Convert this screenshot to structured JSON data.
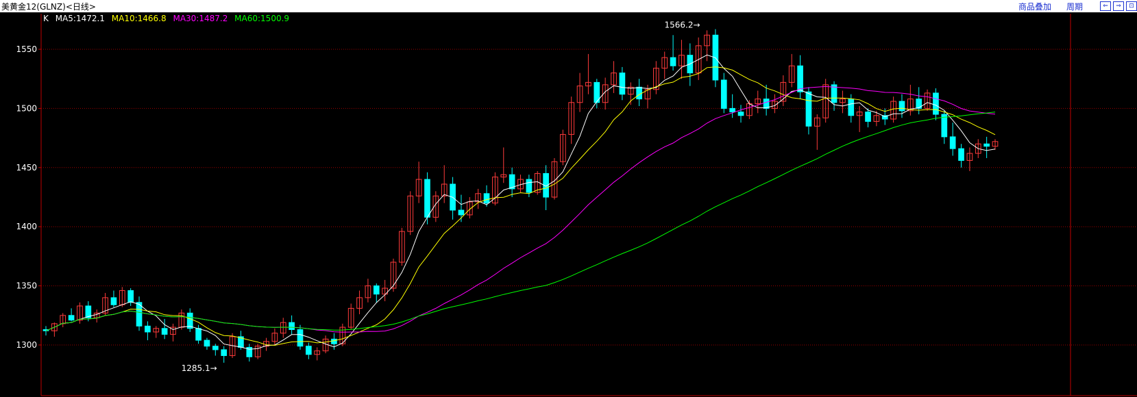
{
  "window": {
    "title": "美黄金12(GLNZ)<日线>",
    "toolbar": {
      "overlay": "商品叠加",
      "period": "周期"
    },
    "buttons": [
      "⇐",
      "⇒",
      "⊡"
    ]
  },
  "legend": {
    "k": "K",
    "ma5": "MA5:1472.1",
    "ma10": "MA10:1466.8",
    "ma30": "MA30:1487.2",
    "ma60": "MA60:1500.9"
  },
  "colors": {
    "background": "#000000",
    "up": "#ff3b3b",
    "down": "#00ffff",
    "ma5": "#ffffff",
    "ma10": "#ffff00",
    "ma30": "#ff00ff",
    "ma60": "#00ff00",
    "grid": "#9e0000",
    "axis": "#c00000"
  },
  "chart_data": {
    "type": "candlestick",
    "y_ticks": [
      1300,
      1350,
      1400,
      1450,
      1500,
      1550
    ],
    "ylim": [
      1285,
      1570
    ],
    "annotations": [
      {
        "label": "1566.2",
        "candle_index": 78
      },
      {
        "label": "1285.1",
        "candle_index": 21
      }
    ],
    "candles": [
      [
        1313,
        1316,
        1308,
        1312
      ],
      [
        1312,
        1319,
        1307,
        1318
      ],
      [
        1318,
        1327,
        1315,
        1325
      ],
      [
        1325,
        1331,
        1320,
        1321
      ],
      [
        1321,
        1336,
        1318,
        1333
      ],
      [
        1333,
        1337,
        1320,
        1323
      ],
      [
        1323,
        1330,
        1319,
        1327
      ],
      [
        1327,
        1344,
        1325,
        1340
      ],
      [
        1340,
        1346,
        1332,
        1334
      ],
      [
        1334,
        1349,
        1332,
        1346
      ],
      [
        1346,
        1348,
        1333,
        1336
      ],
      [
        1336,
        1341,
        1312,
        1316
      ],
      [
        1316,
        1320,
        1304,
        1311
      ],
      [
        1311,
        1316,
        1306,
        1314
      ],
      [
        1314,
        1322,
        1305,
        1309
      ],
      [
        1309,
        1318,
        1303,
        1315
      ],
      [
        1315,
        1330,
        1313,
        1327
      ],
      [
        1327,
        1331,
        1311,
        1314
      ],
      [
        1314,
        1317,
        1301,
        1304
      ],
      [
        1304,
        1306,
        1296,
        1299
      ],
      [
        1299,
        1301,
        1291,
        1296
      ],
      [
        1296,
        1299,
        1285,
        1291
      ],
      [
        1291,
        1310,
        1289,
        1307
      ],
      [
        1307,
        1312,
        1296,
        1298
      ],
      [
        1298,
        1301,
        1286,
        1290
      ],
      [
        1290,
        1301,
        1288,
        1299
      ],
      [
        1299,
        1306,
        1295,
        1303
      ],
      [
        1303,
        1314,
        1300,
        1310
      ],
      [
        1310,
        1323,
        1306,
        1319
      ],
      [
        1319,
        1325,
        1309,
        1313
      ],
      [
        1313,
        1317,
        1296,
        1299
      ],
      [
        1299,
        1302,
        1288,
        1292
      ],
      [
        1292,
        1298,
        1287,
        1295
      ],
      [
        1295,
        1308,
        1293,
        1305
      ],
      [
        1305,
        1310,
        1296,
        1301
      ],
      [
        1301,
        1318,
        1299,
        1315
      ],
      [
        1315,
        1335,
        1313,
        1331
      ],
      [
        1331,
        1346,
        1326,
        1340
      ],
      [
        1340,
        1356,
        1336,
        1350
      ],
      [
        1350,
        1352,
        1336,
        1343
      ],
      [
        1343,
        1355,
        1337,
        1348
      ],
      [
        1348,
        1373,
        1345,
        1370
      ],
      [
        1370,
        1399,
        1367,
        1396
      ],
      [
        1396,
        1430,
        1393,
        1426
      ],
      [
        1426,
        1455,
        1420,
        1440
      ],
      [
        1440,
        1446,
        1402,
        1408
      ],
      [
        1408,
        1430,
        1404,
        1426
      ],
      [
        1426,
        1452,
        1420,
        1436
      ],
      [
        1436,
        1442,
        1406,
        1414
      ],
      [
        1414,
        1427,
        1404,
        1410
      ],
      [
        1410,
        1425,
        1407,
        1421
      ],
      [
        1421,
        1432,
        1415,
        1428
      ],
      [
        1428,
        1435,
        1417,
        1420
      ],
      [
        1420,
        1446,
        1418,
        1442
      ],
      [
        1442,
        1467,
        1437,
        1444
      ],
      [
        1444,
        1450,
        1425,
        1432
      ],
      [
        1432,
        1444,
        1429,
        1440
      ],
      [
        1440,
        1444,
        1425,
        1429
      ],
      [
        1429,
        1447,
        1427,
        1445
      ],
      [
        1445,
        1452,
        1414,
        1425
      ],
      [
        1425,
        1458,
        1423,
        1455
      ],
      [
        1455,
        1482,
        1452,
        1478
      ],
      [
        1478,
        1510,
        1470,
        1505
      ],
      [
        1505,
        1530,
        1497,
        1519
      ],
      [
        1519,
        1546,
        1512,
        1522
      ],
      [
        1522,
        1525,
        1500,
        1505
      ],
      [
        1505,
        1526,
        1499,
        1520
      ],
      [
        1520,
        1540,
        1513,
        1530
      ],
      [
        1530,
        1535,
        1507,
        1512
      ],
      [
        1512,
        1522,
        1503,
        1518
      ],
      [
        1518,
        1525,
        1502,
        1508
      ],
      [
        1508,
        1520,
        1500,
        1516
      ],
      [
        1516,
        1540,
        1512,
        1534
      ],
      [
        1534,
        1548,
        1525,
        1543
      ],
      [
        1543,
        1562,
        1532,
        1536
      ],
      [
        1536,
        1558,
        1525,
        1545
      ],
      [
        1545,
        1555,
        1519,
        1530
      ],
      [
        1530,
        1560,
        1524,
        1553
      ],
      [
        1553,
        1566,
        1540,
        1562
      ],
      [
        1562,
        1567,
        1518,
        1524
      ],
      [
        1524,
        1530,
        1496,
        1500
      ],
      [
        1500,
        1512,
        1492,
        1497
      ],
      [
        1497,
        1503,
        1488,
        1494
      ],
      [
        1494,
        1507,
        1491,
        1504
      ],
      [
        1504,
        1515,
        1496,
        1508
      ],
      [
        1508,
        1520,
        1494,
        1500
      ],
      [
        1500,
        1512,
        1496,
        1506
      ],
      [
        1506,
        1528,
        1502,
        1522
      ],
      [
        1522,
        1546,
        1518,
        1536
      ],
      [
        1536,
        1545,
        1508,
        1514
      ],
      [
        1514,
        1518,
        1478,
        1485
      ],
      [
        1485,
        1495,
        1465,
        1492
      ],
      [
        1492,
        1525,
        1488,
        1520
      ],
      [
        1520,
        1523,
        1498,
        1505
      ],
      [
        1505,
        1515,
        1496,
        1508
      ],
      [
        1508,
        1512,
        1488,
        1494
      ],
      [
        1494,
        1502,
        1480,
        1497
      ],
      [
        1497,
        1500,
        1484,
        1489
      ],
      [
        1489,
        1498,
        1485,
        1494
      ],
      [
        1494,
        1500,
        1486,
        1491
      ],
      [
        1491,
        1510,
        1488,
        1506
      ],
      [
        1506,
        1512,
        1492,
        1498
      ],
      [
        1498,
        1520,
        1494,
        1508
      ],
      [
        1508,
        1518,
        1495,
        1500
      ],
      [
        1500,
        1516,
        1498,
        1513
      ],
      [
        1513,
        1517,
        1490,
        1495
      ],
      [
        1495,
        1498,
        1470,
        1476
      ],
      [
        1476,
        1488,
        1460,
        1466
      ],
      [
        1466,
        1470,
        1450,
        1456
      ],
      [
        1456,
        1467,
        1447,
        1462
      ],
      [
        1462,
        1474,
        1458,
        1470
      ],
      [
        1470,
        1476,
        1458,
        1468
      ],
      [
        1468,
        1474,
        1465,
        1472
      ]
    ]
  }
}
